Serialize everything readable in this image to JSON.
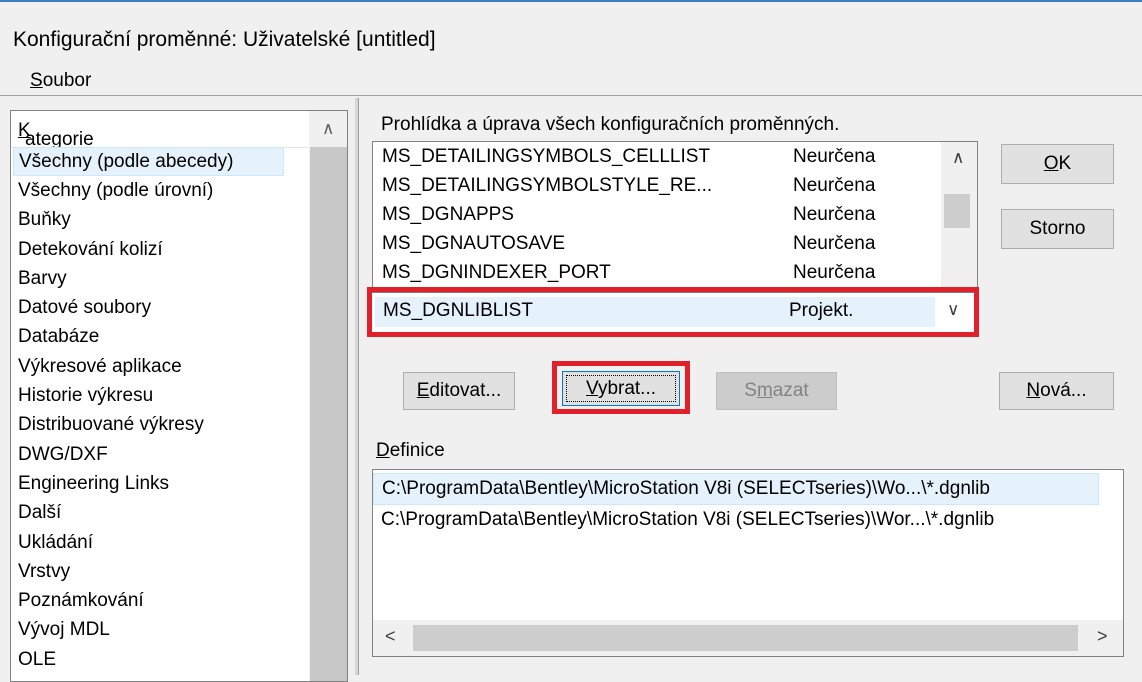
{
  "window": {
    "title": "Konfigurační proměnné: Uživatelské [untitled]"
  },
  "menu": {
    "file_first": "S",
    "file_rest": "oubor"
  },
  "categories": {
    "header_first": "K",
    "header_rest": "ategorie",
    "items": [
      "Všechny (podle abecedy)",
      "Všechny (podle úrovní)",
      "Buňky",
      "Detekování kolizí",
      "Barvy",
      "Datové soubory",
      "Databáze",
      "Výkresové aplikace",
      "Historie výkresu",
      "Distribuované výkresy",
      "DWG/DXF",
      "Engineering Links",
      "Další",
      "Ukládání",
      "Vrstvy",
      "Poznámkování",
      "Vývoj MDL",
      "OLE"
    ],
    "selected_index": 0
  },
  "description": "Prohlídka a úprava všech konfiguračních proměnných.",
  "variables": {
    "rows": [
      {
        "name": "MS_DETAILINGSYMBOLS_CELLLIST",
        "level": "Neurčena"
      },
      {
        "name": "MS_DETAILINGSYMBOLSTYLE_RE...",
        "level": "Neurčena"
      },
      {
        "name": "MS_DGNAPPS",
        "level": "Neurčena"
      },
      {
        "name": "MS_DGNAUTOSAVE",
        "level": "Neurčena"
      },
      {
        "name": "MS_DGNINDEXER_PORT",
        "level": "Neurčena"
      }
    ],
    "selected": {
      "name": "MS_DGNLIBLIST",
      "level": "Projekt."
    }
  },
  "buttons": {
    "ok_first": "O",
    "ok_rest": "K",
    "cancel": "Storno",
    "edit_first": "E",
    "edit_rest": "ditovat...",
    "select_first": "V",
    "select_rest": "ybrat...",
    "delete_pre": "S",
    "delete_u": "m",
    "delete_post": "azat",
    "new_first": "N",
    "new_rest": "ová..."
  },
  "definition": {
    "label_first": "D",
    "label_rest": "efinice",
    "lines": [
      "C:\\ProgramData\\Bentley\\MicroStation V8i (SELECTseries)\\Wo...\\*.dgnlib",
      "C:\\ProgramData\\Bentley\\MicroStation V8i (SELECTseries)\\Wor...\\*.dgnlib"
    ]
  },
  "icons": {
    "scroll_up": "chevron-up-icon",
    "scroll_down": "chevron-down-icon",
    "scroll_left": "chevron-left-icon",
    "scroll_right": "chevron-right-icon"
  },
  "colors": {
    "highlight": "#e0202a",
    "selection": "#e5f1fb",
    "title_bar_line": "#3c7fc0"
  }
}
